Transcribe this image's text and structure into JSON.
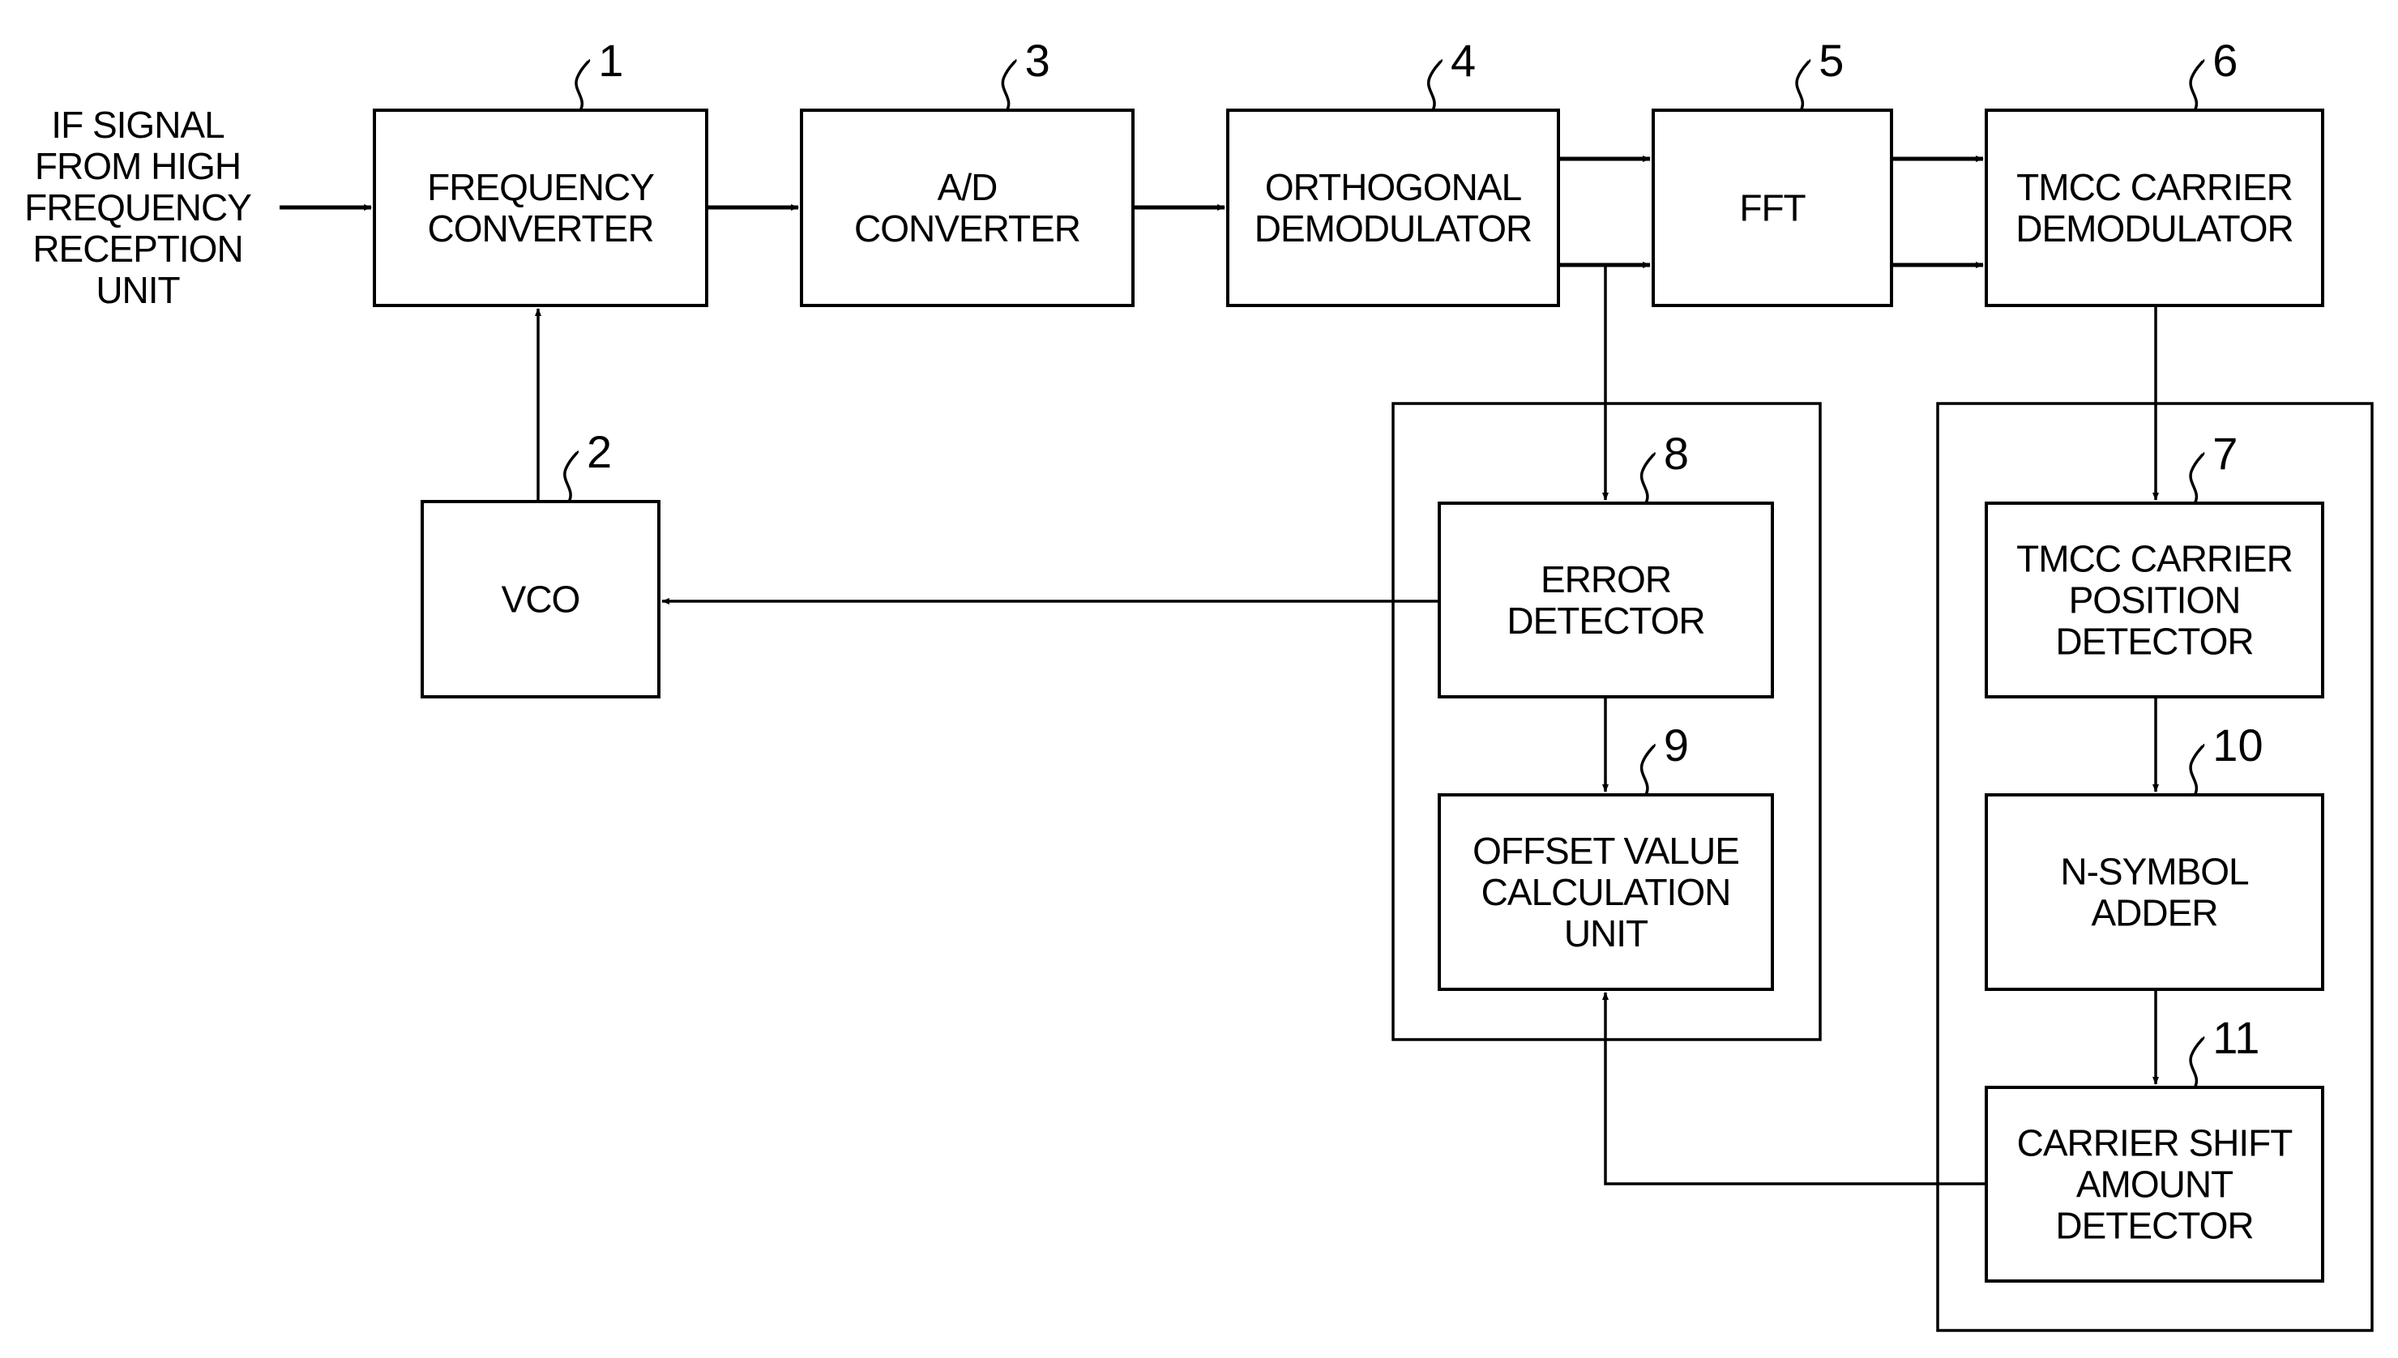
{
  "input_label": [
    "IF SIGNAL",
    "FROM HIGH",
    "FREQUENCY",
    "RECEPTION",
    "UNIT"
  ],
  "blocks": {
    "frequency_converter": {
      "ref": "1",
      "lines": [
        "FREQUENCY",
        "CONVERTER"
      ]
    },
    "vco": {
      "ref": "2",
      "lines": [
        "VCO"
      ]
    },
    "ad_converter": {
      "ref": "3",
      "lines": [
        "A/D",
        "CONVERTER"
      ]
    },
    "orthogonal_demodulator": {
      "ref": "4",
      "lines": [
        "ORTHOGONAL",
        "DEMODULATOR"
      ]
    },
    "fft": {
      "ref": "5",
      "lines": [
        "FFT"
      ]
    },
    "tmcc_carrier_demodulator": {
      "ref": "6",
      "lines": [
        "TMCC CARRIER",
        "DEMODULATOR"
      ]
    },
    "tmcc_carrier_position_detector": {
      "ref": "7",
      "lines": [
        "TMCC CARRIER",
        "POSITION",
        "DETECTOR"
      ]
    },
    "error_detector": {
      "ref": "8",
      "lines": [
        "ERROR",
        "DETECTOR"
      ]
    },
    "offset_value_calculation_unit": {
      "ref": "9",
      "lines": [
        "OFFSET VALUE",
        "CALCULATION",
        "UNIT"
      ]
    },
    "n_symbol_adder": {
      "ref": "10",
      "lines": [
        "N-SYMBOL",
        "ADDER"
      ]
    },
    "carrier_shift_amount_detector": {
      "ref": "11",
      "lines": [
        "CARRIER SHIFT",
        "AMOUNT",
        "DETECTOR"
      ]
    }
  },
  "connections": [
    {
      "from": "input",
      "to": "frequency_converter"
    },
    {
      "from": "frequency_converter",
      "to": "ad_converter"
    },
    {
      "from": "ad_converter",
      "to": "orthogonal_demodulator"
    },
    {
      "from": "orthogonal_demodulator",
      "to": "fft",
      "count": 2
    },
    {
      "from": "fft",
      "to": "tmcc_carrier_demodulator",
      "count": 2
    },
    {
      "from": "vco",
      "to": "frequency_converter"
    },
    {
      "from": "orthogonal_demodulator",
      "to": "error_detector"
    },
    {
      "from": "error_detector",
      "to": "vco"
    },
    {
      "from": "error_detector",
      "to": "offset_value_calculation_unit"
    },
    {
      "from": "tmcc_carrier_demodulator",
      "to": "tmcc_carrier_position_detector"
    },
    {
      "from": "tmcc_carrier_position_detector",
      "to": "n_symbol_adder"
    },
    {
      "from": "n_symbol_adder",
      "to": "carrier_shift_amount_detector"
    },
    {
      "from": "carrier_shift_amount_detector",
      "to": "offset_value_calculation_unit"
    }
  ]
}
